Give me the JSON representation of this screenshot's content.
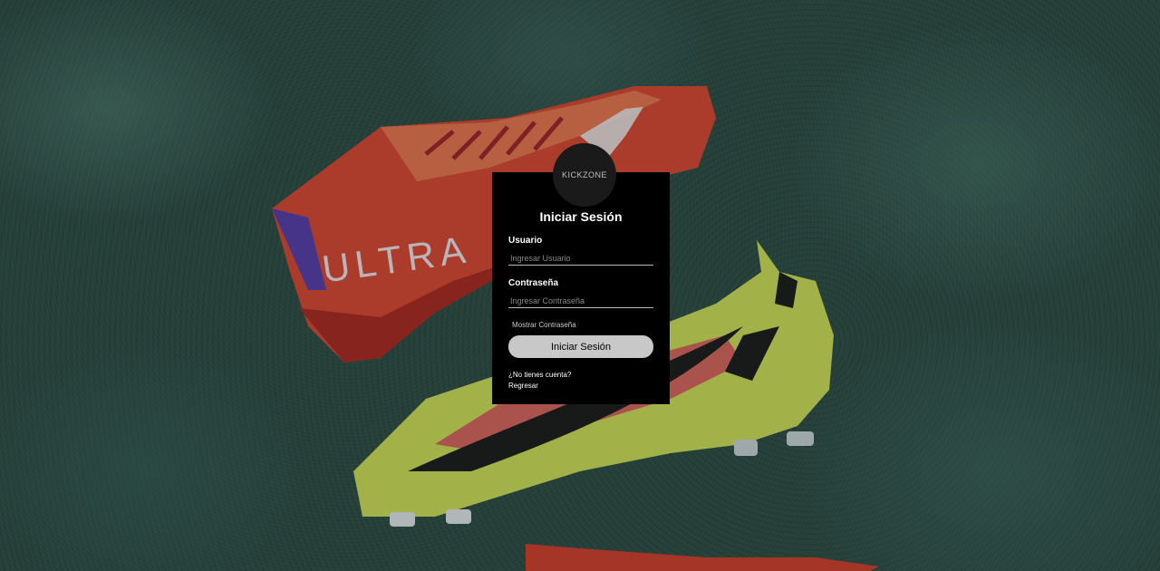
{
  "brand": {
    "logo_text": "KICKZONE"
  },
  "login": {
    "title": "Iniciar Sesión",
    "username_label": "Usuario",
    "username_placeholder": "Ingresar Usuario",
    "password_label": "Contraseña",
    "password_placeholder": "Ingresar Contraseña",
    "show_password": "Mostrar Contraseña",
    "submit_label": "Iniciar Sesión",
    "no_account_link": "¿No tienes cuenta?",
    "back_link": "Regresar"
  },
  "background": {
    "boot_text": "ULTRA",
    "colors": {
      "turf": "#2f4f47",
      "card": "#000000",
      "button": "#c8c8c8",
      "red_boot": "#e8442e",
      "yellow_boot": "#d6e85a"
    }
  }
}
